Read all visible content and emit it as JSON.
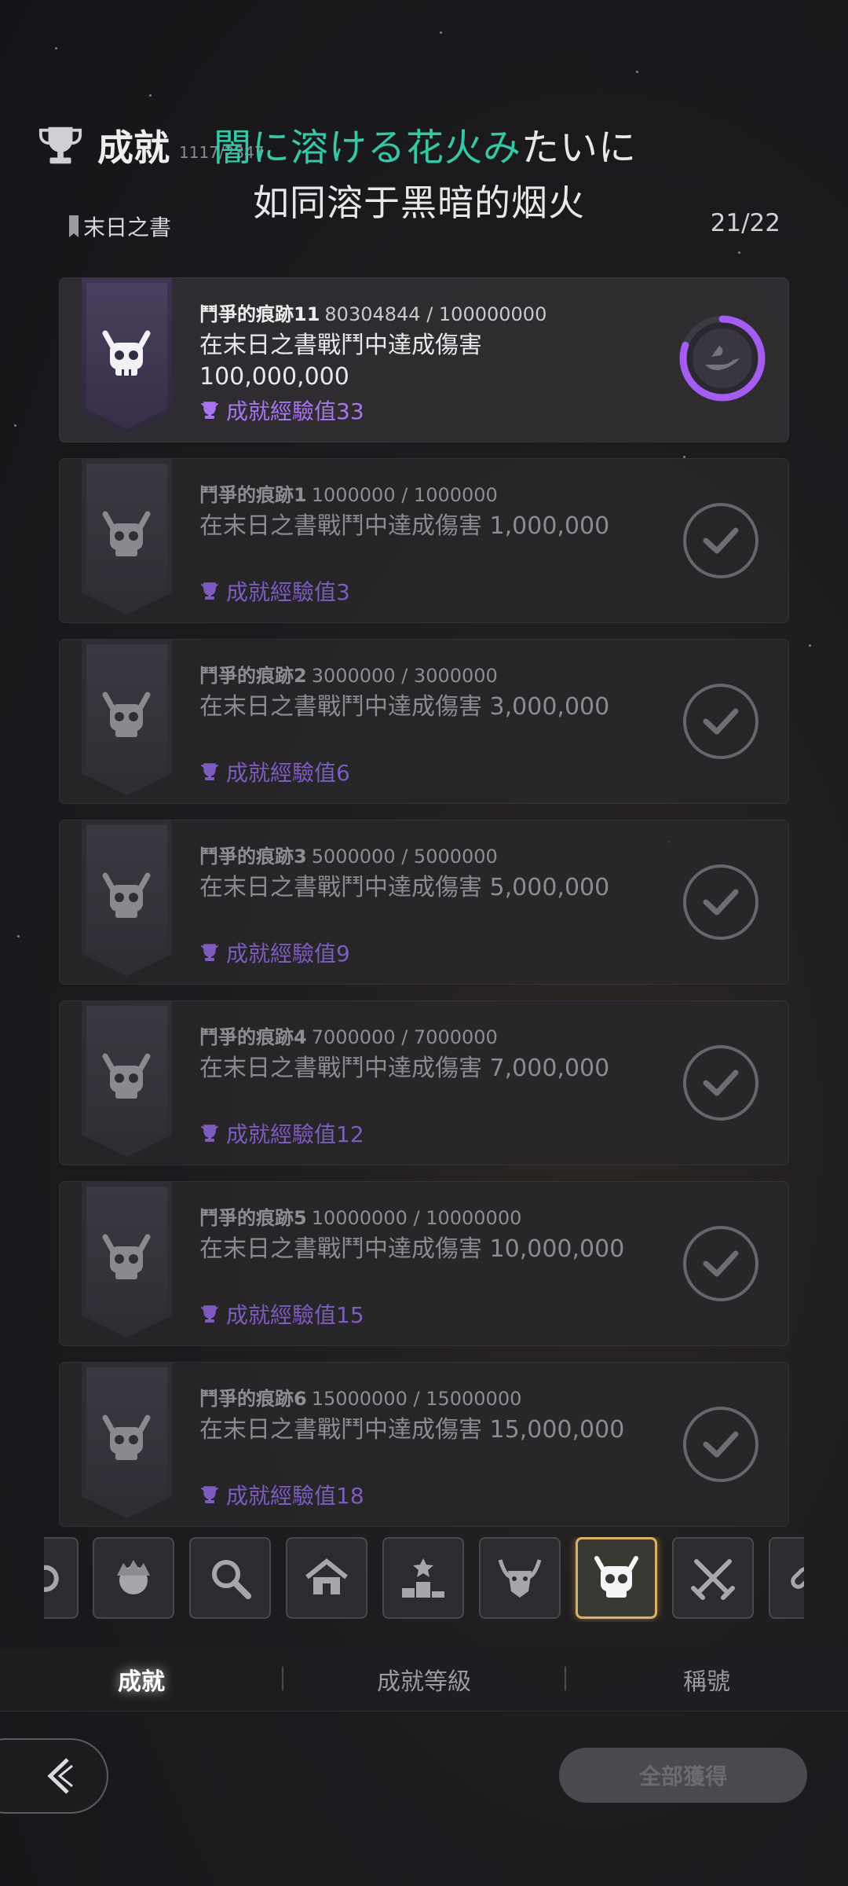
{
  "header": {
    "title": "成就",
    "score": "1117/2347",
    "lyric_highlight": "闇に溶ける花火み",
    "lyric_rest": "たいに",
    "lyric_translation": "如同溶于黑暗的烟火",
    "book_label": "末日之書",
    "progress": "21/22"
  },
  "achievements": [
    {
      "name": "鬥爭的痕跡11",
      "value": "80304844 / 100000000",
      "desc": "在末日之書戰鬥中達成傷害 100,000,000",
      "reward": "成就經驗值33",
      "status": "in-progress",
      "progress_fraction": 0.803
    },
    {
      "name": "鬥爭的痕跡1",
      "value": "1000000 / 1000000",
      "desc": "在末日之書戰鬥中達成傷害 1,000,000",
      "reward": "成就經驗值3",
      "status": "completed"
    },
    {
      "name": "鬥爭的痕跡2",
      "value": "3000000 / 3000000",
      "desc": "在末日之書戰鬥中達成傷害 3,000,000",
      "reward": "成就經驗值6",
      "status": "completed"
    },
    {
      "name": "鬥爭的痕跡3",
      "value": "5000000 / 5000000",
      "desc": "在末日之書戰鬥中達成傷害 5,000,000",
      "reward": "成就經驗值9",
      "status": "completed"
    },
    {
      "name": "鬥爭的痕跡4",
      "value": "7000000 / 7000000",
      "desc": "在末日之書戰鬥中達成傷害 7,000,000",
      "reward": "成就經驗值12",
      "status": "completed"
    },
    {
      "name": "鬥爭的痕跡5",
      "value": "10000000 / 10000000",
      "desc": "在末日之書戰鬥中達成傷害 10,000,000",
      "reward": "成就經驗值15",
      "status": "completed"
    },
    {
      "name": "鬥爭的痕跡6",
      "value": "15000000 / 15000000",
      "desc": "在末日之書戰鬥中達成傷害 15,000,000",
      "reward": "成就經驗值18",
      "status": "completed"
    }
  ],
  "categories": [
    {
      "icon": "swirl-icon",
      "selected": false
    },
    {
      "icon": "face-icon",
      "selected": false
    },
    {
      "icon": "magnifier-icon",
      "selected": false
    },
    {
      "icon": "house-icon",
      "selected": false
    },
    {
      "icon": "podium-icon",
      "selected": false
    },
    {
      "icon": "demon-icon",
      "selected": false
    },
    {
      "icon": "horned-skull-icon",
      "selected": true
    },
    {
      "icon": "crossed-swords-icon",
      "selected": false
    },
    {
      "icon": "chain-icon",
      "selected": false
    }
  ],
  "tabs": [
    {
      "label": "成就",
      "active": true
    },
    {
      "label": "成就等級",
      "active": false
    },
    {
      "label": "稱號",
      "active": false
    }
  ],
  "buttons": {
    "claim_all": "全部獲得"
  },
  "colors": {
    "lyric_highlight": "#35c7a6",
    "reward_purple": "#a874f0",
    "progress_ring": "#a45cf2",
    "selected_category_border": "#d9b263"
  }
}
